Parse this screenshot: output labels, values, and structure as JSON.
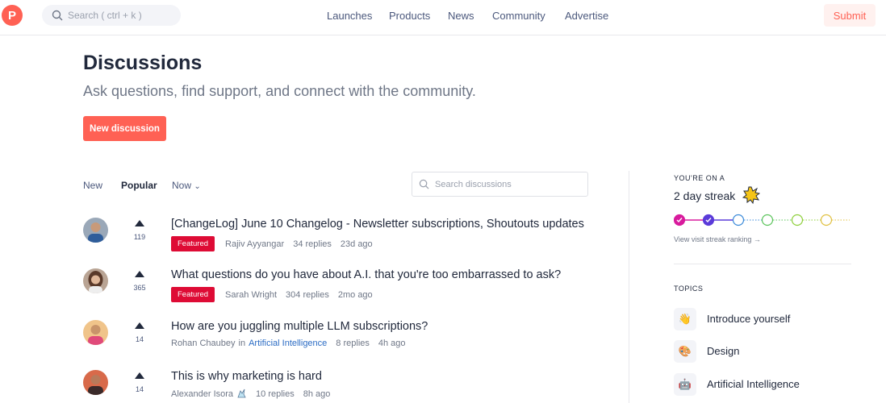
{
  "header": {
    "logo_letter": "P",
    "search_placeholder": "Search ( ctrl + k )",
    "nav": [
      "Launches",
      "Products",
      "News",
      "Community",
      "Advertise"
    ],
    "submit_label": "Submit"
  },
  "hero": {
    "title": "Discussions",
    "subtitle": "Ask questions, find support, and connect with the community.",
    "new_button": "New discussion"
  },
  "filters": {
    "items": [
      "New",
      "Popular",
      "Now"
    ],
    "active": "Popular",
    "search_placeholder": "Search discussions"
  },
  "discussions": [
    {
      "title": "[ChangeLog] June 10 Changelog - Newsletter subscriptions, Shoutouts updates",
      "votes": "119",
      "badge": "Featured",
      "author": "Rajiv Ayyangar",
      "replies": "34 replies",
      "age": "23d ago",
      "avatar_color": "#3a6ea5"
    },
    {
      "title": "What questions do you have about A.I. that you're too embarrassed to ask?",
      "votes": "365",
      "badge": "Featured",
      "author": "Sarah Wright",
      "replies": "304 replies",
      "age": "2mo ago",
      "avatar_color": "#8a6a58"
    },
    {
      "title": "How are you juggling multiple LLM subscriptions?",
      "votes": "14",
      "author": "Rohan Chaubey",
      "in_label": "in",
      "topic_link": "Artificial Intelligence",
      "replies": "8 replies",
      "age": "4h ago",
      "avatar_color": "#e0a060"
    },
    {
      "title": "This is why marketing is hard",
      "votes": "14",
      "author": "Alexander Isora",
      "replies": "10 replies",
      "age": "8h ago",
      "avatar_color": "#c05040"
    }
  ],
  "sidebar": {
    "streak_label": "YOU'RE ON A",
    "streak_value": "2 day streak",
    "streak_days": 2,
    "streak_colors": [
      "#d81b9d",
      "#5b3bd9",
      "#3b8ad9",
      "#5bc45b",
      "#8ecf3b",
      "#e0c040"
    ],
    "ranking_link": "View visit streak ranking →",
    "topics_label": "TOPICS",
    "topics": [
      {
        "name": "Introduce yourself",
        "icon": "👋"
      },
      {
        "name": "Design",
        "icon": "🎨"
      },
      {
        "name": "Artificial Intelligence",
        "icon": "🤖"
      }
    ]
  }
}
